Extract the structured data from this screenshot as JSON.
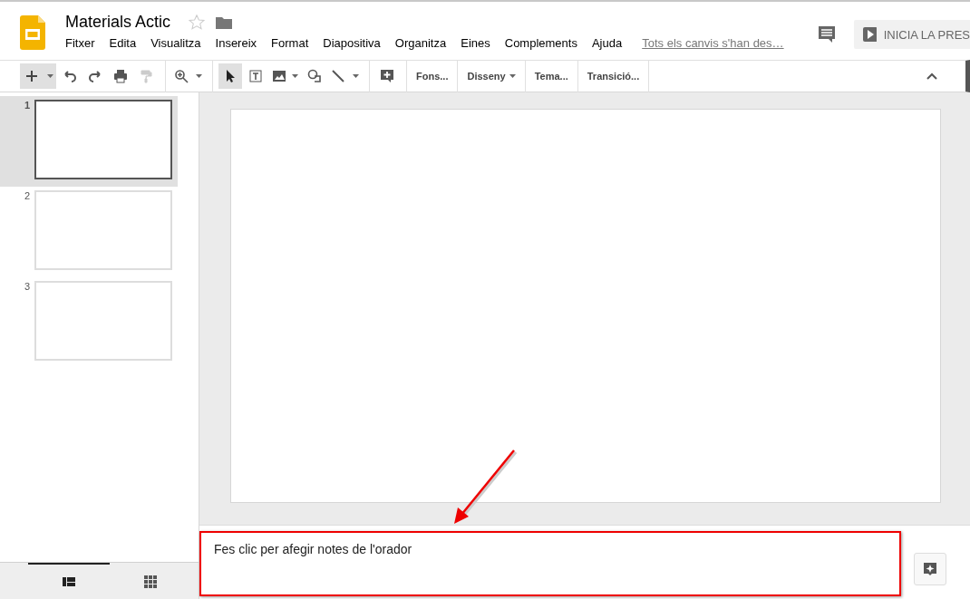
{
  "document": {
    "title": "Materials Actic",
    "starred": false
  },
  "menu": [
    "Fitxer",
    "Edita",
    "Visualitza",
    "Insereix",
    "Format",
    "Diapositiva",
    "Organitza",
    "Eines",
    "Complements",
    "Ajuda"
  ],
  "save_status": "Tots els canvis s'han des…",
  "present_button": "INICIA LA PRES",
  "toolbar_buttons": [
    {
      "label": "Fons...",
      "dropdown": false
    },
    {
      "label": "Disseny",
      "dropdown": true
    },
    {
      "label": "Tema...",
      "dropdown": false
    },
    {
      "label": "Transició...",
      "dropdown": false
    }
  ],
  "slides": [
    {
      "number": "1",
      "selected": true
    },
    {
      "number": "2",
      "selected": false
    },
    {
      "number": "3",
      "selected": false
    }
  ],
  "view_tabs": [
    {
      "kind": "filmstrip",
      "selected": true
    },
    {
      "kind": "grid",
      "selected": false
    }
  ],
  "notes": {
    "placeholder": "Fes clic per afegir notes de l'orador"
  },
  "annotation": {
    "kind": "arrow-and-frame"
  }
}
